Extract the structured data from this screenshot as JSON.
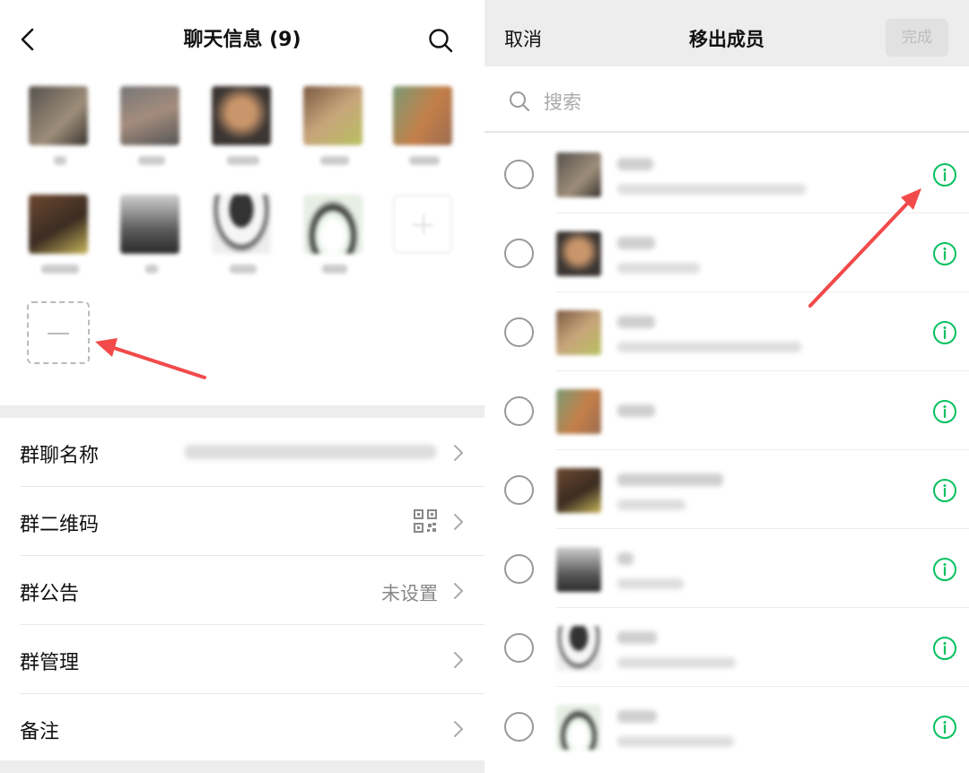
{
  "left_panel": {
    "title": "聊天信息 (9)",
    "icons": {
      "back": "chevron-left-icon",
      "search": "search-icon",
      "chevron": "chevron-right-icon",
      "qr": "qr-code-icon"
    },
    "settings": {
      "group_name": {
        "label": "群聊名称"
      },
      "group_qr": {
        "label": "群二维码"
      },
      "announcement": {
        "label": "群公告",
        "value": "未设置"
      },
      "management": {
        "label": "群管理"
      },
      "remark": {
        "label": "备注"
      }
    }
  },
  "right_panel": {
    "cancel_label": "取消",
    "title": "移出成员",
    "done_label": "完成",
    "search_placeholder": "搜索",
    "icons": {
      "search": "search-icon",
      "info": "info-icon",
      "radio": "radio-unchecked-icon"
    }
  },
  "colors": {
    "accent_green": "#07c160",
    "annotation_red": "#f24a4a",
    "header_gray": "#ededed",
    "done_disabled_text": "#bdbdbd"
  }
}
